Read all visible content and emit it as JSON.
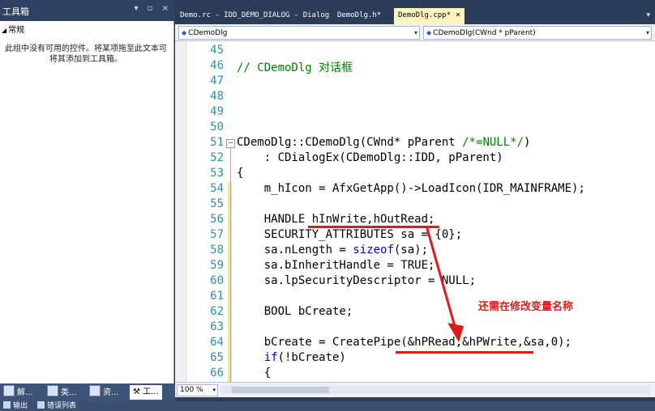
{
  "toolbox": {
    "title": "工具箱",
    "title_buttons": "▾ ▫ ×",
    "group_label": "常规",
    "empty_text": "此组中没有可用的控件。将某项拖至此文本可将其添加到工具箱。",
    "tabs": [
      {
        "label": "解..."
      },
      {
        "label": "类..."
      },
      {
        "label": "资..."
      },
      {
        "label": "工..."
      }
    ]
  },
  "bottom_tabs": [
    {
      "label": "输出"
    },
    {
      "label": "错误列表"
    }
  ],
  "document_tabs": [
    {
      "label": "Demo.rc - IDD_DEMO_DIALOG - Dialog"
    },
    {
      "label": "DemoDlg.h*"
    },
    {
      "label": "DemoDlg.cpp*",
      "close": "×"
    }
  ],
  "nav": {
    "class_combo": "CDemoDlg",
    "member_combo": "CDemoDlg(CWnd * pParent)"
  },
  "status": {
    "zoom": "100 %"
  },
  "code": {
    "line_numbers": [
      "45",
      "46",
      "47",
      "48",
      "49",
      "50",
      "51",
      "52",
      "53",
      "54",
      "55",
      "56",
      "57",
      "58",
      "59",
      "60",
      "61",
      "62",
      "63",
      "64",
      "65",
      "66"
    ],
    "line_46": "// CDemoDlg 对话框",
    "line_51a": "CDemoDlg::CDemoDlg(CWnd* pParent ",
    "line_51b": "/*=NULL*/",
    "line_51c": ")",
    "line_52": "    : CDialogEx(CDemoDlg::IDD, pParent)",
    "line_53": "{",
    "line_54": "    m_hIcon = AfxGetApp()->LoadIcon(IDR_MAINFRAME);",
    "line_56": "    HANDLE hInWrite,hOutRead;",
    "line_57": "    SECURITY_ATTRIBUTES sa = {0};",
    "line_58a": "    sa.nLength = ",
    "line_58b": "sizeof",
    "line_58c": "(sa);",
    "line_59": "    sa.bInheritHandle = TRUE;",
    "line_60": "    sa.lpSecurityDescriptor = NULL;",
    "line_62": "    BOOL bCreate;",
    "line_64": "    bCreate = CreatePipe(&hPRead,&hPWrite,&sa,0);",
    "line_65a": "    ",
    "line_65b": "if",
    "line_65c": "(!bCreate)",
    "line_66": "    {"
  },
  "annotation": {
    "note": "还需在修改变量名称",
    "color": "#e0191a"
  }
}
